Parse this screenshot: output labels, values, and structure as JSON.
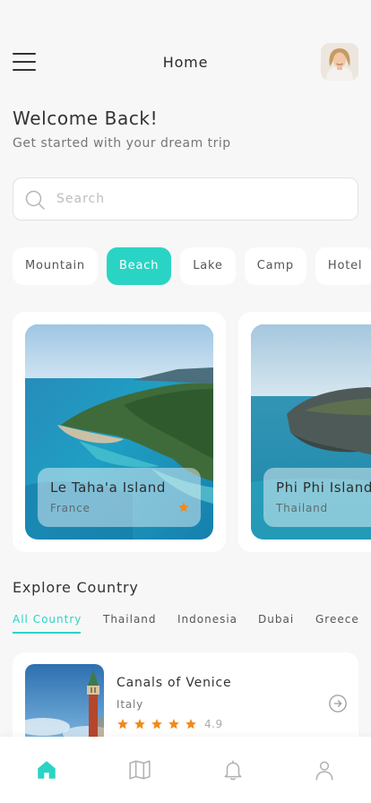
{
  "header": {
    "title": "Home",
    "menu_icon": "hamburger-menu-icon",
    "avatar_icon": "user-avatar"
  },
  "welcome": {
    "title": "Welcome Back!",
    "subtitle": "Get started with your dream trip"
  },
  "search": {
    "placeholder": "Search",
    "value": "",
    "icon": "search-icon"
  },
  "categories": [
    {
      "label": "Mountain",
      "active": false
    },
    {
      "label": "Beach",
      "active": true
    },
    {
      "label": "Lake",
      "active": false
    },
    {
      "label": "Camp",
      "active": false
    },
    {
      "label": "Hotel",
      "active": false
    }
  ],
  "featured": [
    {
      "title": "Le Taha'a Island",
      "country": "France",
      "favorite": true
    },
    {
      "title": "Phi Phi Islands",
      "country": "Thailand",
      "favorite": false
    }
  ],
  "explore": {
    "title": "Explore Country",
    "tabs": [
      {
        "label": "All Country",
        "active": true
      },
      {
        "label": "Thailand",
        "active": false
      },
      {
        "label": "Indonesia",
        "active": false
      },
      {
        "label": "Dubai",
        "active": false
      },
      {
        "label": "Greece",
        "active": false
      }
    ]
  },
  "destinations": [
    {
      "title": "Canals of Venice",
      "country": "Italy",
      "rating": "4.9",
      "stars": 5
    }
  ],
  "bottom_nav": [
    {
      "name": "home-icon",
      "active": true
    },
    {
      "name": "map-icon",
      "active": false
    },
    {
      "name": "bell-icon",
      "active": false
    },
    {
      "name": "profile-icon",
      "active": false
    }
  ],
  "colors": {
    "accent": "#2ad4c4",
    "star": "#f08a1c",
    "background": "#f7f7f7"
  }
}
